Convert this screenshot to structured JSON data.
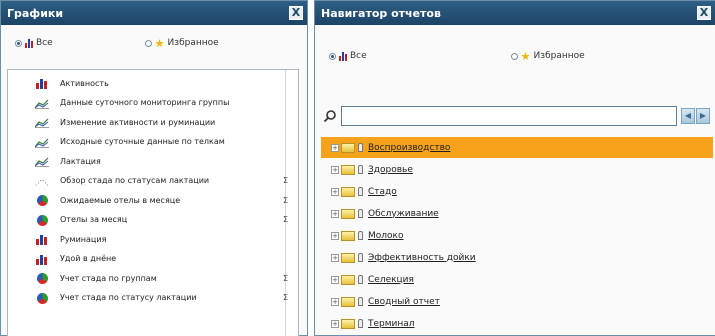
{
  "graphs_panel": {
    "title": "Графики",
    "close": "X",
    "filter_all": "Все",
    "filter_favorites": "Избранное",
    "items": [
      {
        "label": "Активность",
        "icon": "bar-chart-icon",
        "badge": ""
      },
      {
        "label": "Данные суточного мониторинга группы",
        "icon": "line-chart-icon",
        "badge": ""
      },
      {
        "label": "Изменение активности и руминации",
        "icon": "line-chart-icon",
        "badge": ""
      },
      {
        "label": "Исходные суточные данные по телкам",
        "icon": "line-chart-icon",
        "badge": ""
      },
      {
        "label": "Лактация",
        "icon": "line-chart-icon",
        "badge": ""
      },
      {
        "label": "Обзор стада по статусам лактации",
        "icon": "scatter-chart-icon",
        "badge": "Σ"
      },
      {
        "label": "Ожидаемые отелы в месяце",
        "icon": "pie-chart-icon",
        "badge": "Σ"
      },
      {
        "label": "Отелы за месяц",
        "icon": "pie-chart-icon",
        "badge": "Σ"
      },
      {
        "label": "Руминация",
        "icon": "bar-chart-icon",
        "badge": ""
      },
      {
        "label": "Удой в днёне",
        "icon": "bar-chart-icon",
        "badge": ""
      },
      {
        "label": "Учет стада по группам",
        "icon": "pie-chart-icon",
        "badge": "Σ"
      },
      {
        "label": "Учет стада по статусу лактации",
        "icon": "pie-chart-icon",
        "badge": "Σ"
      }
    ]
  },
  "navigator_panel": {
    "title": "Навигатор отчетов",
    "close": "X",
    "filter_all": "Все",
    "filter_favorites": "Избранное",
    "search": {
      "value": "",
      "placeholder": ""
    },
    "nav_prev": "◀",
    "nav_next": "▶",
    "tree": [
      {
        "label": "Воспроизводство",
        "selected": true
      },
      {
        "label": "Здоровье",
        "selected": false
      },
      {
        "label": "Стадо",
        "selected": false
      },
      {
        "label": "Обслуживание",
        "selected": false
      },
      {
        "label": "Молоко",
        "selected": false
      },
      {
        "label": "Эффективность дойки",
        "selected": false
      },
      {
        "label": "Селекция",
        "selected": false
      },
      {
        "label": "Сводный отчет",
        "selected": false
      },
      {
        "label": "Терминал",
        "selected": false
      }
    ]
  },
  "colors": {
    "titlebar": "#1c4466",
    "selected_row": "#f7a21b",
    "favorite_star": "#f0b400"
  }
}
